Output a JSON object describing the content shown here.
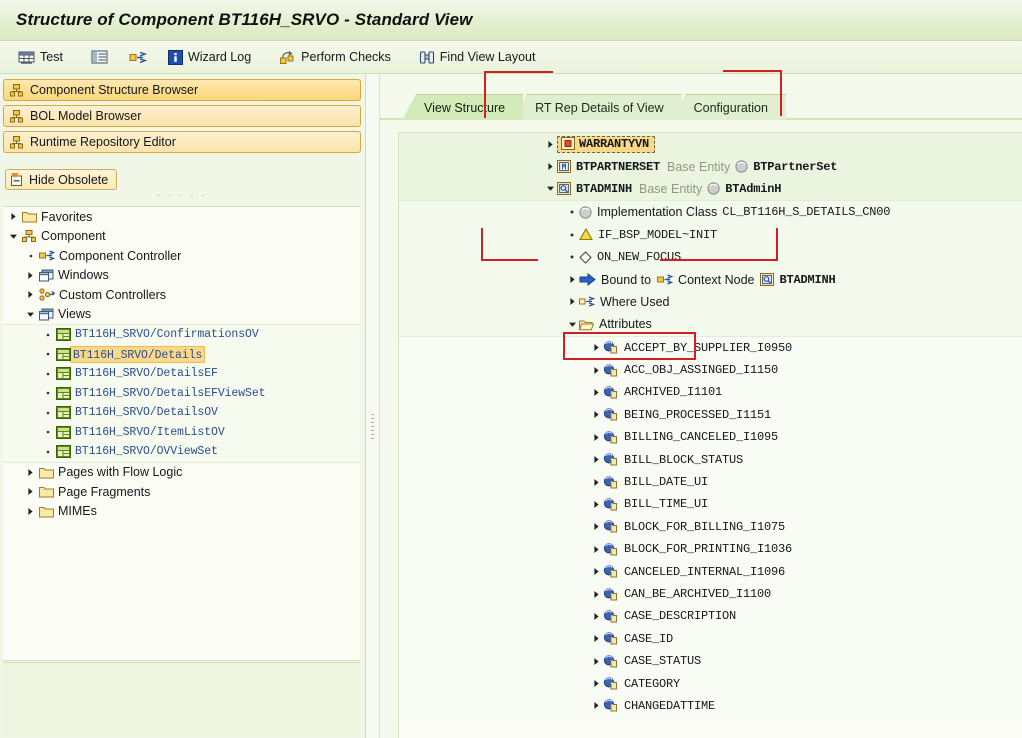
{
  "window": {
    "title": "Structure of Component BT116H_SRVO - Standard View"
  },
  "toolbar": {
    "items": [
      {
        "label": "Test",
        "icon": "test-table-icon"
      },
      {
        "label": "",
        "icon": "list-details-icon"
      },
      {
        "label": "",
        "icon": "navigate-arrows-icon"
      },
      {
        "label": "Wizard Log",
        "icon": "info-blue-icon"
      },
      {
        "label": "Perform Checks",
        "icon": "perform-checks-icon"
      },
      {
        "label": "Find View Layout",
        "icon": "binoculars-icon"
      }
    ]
  },
  "sidebar": {
    "nav_buttons": [
      {
        "label": "Component Structure Browser",
        "icon": "structure-browser-icon",
        "active": true
      },
      {
        "label": "BOL Model Browser",
        "icon": "bol-browser-icon",
        "active": false
      },
      {
        "label": "Runtime Repository Editor",
        "icon": "runtime-repo-icon",
        "active": false
      }
    ],
    "hide_obsolete": {
      "label": "Hide Obsolete",
      "icon": "hide-obsolete-icon"
    },
    "tree": [
      {
        "label": "Favorites",
        "icon": "folder-icon",
        "indent": 0,
        "twisty": "collapsed",
        "style": "plain",
        "band": false
      },
      {
        "label": "Component",
        "icon": "component-icon",
        "indent": 0,
        "twisty": "expanded",
        "style": "plain",
        "band": false
      },
      {
        "label": "Component Controller",
        "icon": "controller-icon",
        "indent": 1,
        "twisty": "leaf",
        "style": "plain",
        "band": false
      },
      {
        "label": "Windows",
        "icon": "windows-icon",
        "indent": 1,
        "twisty": "collapsed",
        "style": "plain",
        "band": false
      },
      {
        "label": "Custom Controllers",
        "icon": "custom-ctrl-icon",
        "indent": 1,
        "twisty": "collapsed",
        "style": "plain",
        "band": false
      },
      {
        "label": "Views",
        "icon": "views-icon",
        "indent": 1,
        "twisty": "expanded",
        "style": "plain",
        "band": false
      },
      {
        "label": "BT116H_SRVO/ConfirmationsOV",
        "icon": "view-icon",
        "indent": 2,
        "twisty": "leaf",
        "style": "link",
        "band": true
      },
      {
        "label": "BT116H_SRVO/Details",
        "icon": "view-icon",
        "indent": 2,
        "twisty": "leaf",
        "style": "selected",
        "band": true
      },
      {
        "label": "BT116H_SRVO/DetailsEF",
        "icon": "view-icon",
        "indent": 2,
        "twisty": "leaf",
        "style": "link",
        "band": true
      },
      {
        "label": "BT116H_SRVO/DetailsEFViewSet",
        "icon": "view-icon",
        "indent": 2,
        "twisty": "leaf",
        "style": "link",
        "band": true
      },
      {
        "label": "BT116H_SRVO/DetailsOV",
        "icon": "view-icon",
        "indent": 2,
        "twisty": "leaf",
        "style": "link",
        "band": true
      },
      {
        "label": "BT116H_SRVO/ItemListOV",
        "icon": "view-icon",
        "indent": 2,
        "twisty": "leaf",
        "style": "link",
        "band": true
      },
      {
        "label": "BT116H_SRVO/OVViewSet",
        "icon": "view-icon",
        "indent": 2,
        "twisty": "leaf",
        "style": "link",
        "band": true
      },
      {
        "label": "Pages with Flow Logic",
        "icon": "folder-icon",
        "indent": 1,
        "twisty": "collapsed",
        "style": "plain",
        "band": false
      },
      {
        "label": "Page Fragments",
        "icon": "folder-icon",
        "indent": 1,
        "twisty": "collapsed",
        "style": "plain",
        "band": false
      },
      {
        "label": "MIMEs",
        "icon": "folder-icon",
        "indent": 1,
        "twisty": "collapsed",
        "style": "plain",
        "band": false
      }
    ]
  },
  "tabs": [
    {
      "label": "View Structure",
      "active": true
    },
    {
      "label": "RT Rep Details of View",
      "active": false
    },
    {
      "label": "Configuration",
      "active": false
    }
  ],
  "view_structure": {
    "rows": [
      {
        "kind": "node-highlight",
        "twisty": "collapsed",
        "icon": "context-node-orange-icon",
        "text": "WARRANTYVN",
        "indent": 0,
        "band": 1
      },
      {
        "kind": "node-entity",
        "twisty": "collapsed",
        "icon": "model-node-icon",
        "text": "BTPARTNERSET",
        "suffix_muted": "Base Entity",
        "suffix_icon": "sphere-grey-icon",
        "suffix_text": "BTPartnerSet",
        "indent": 0,
        "band": 1
      },
      {
        "kind": "node-entity",
        "twisty": "expanded",
        "icon": "context-node-icon",
        "text": "BTADMINH",
        "suffix_muted": "Base Entity",
        "suffix_icon": "sphere-grey-icon",
        "suffix_text": "BTAdminH",
        "indent": 0,
        "band": 1
      },
      {
        "kind": "detail",
        "twisty": "bullet",
        "icon": "sphere-grey-icon",
        "text_sans": "Implementation Class",
        "text_mono": "CL_BT116H_S_DETAILS_CN00",
        "indent": 1,
        "band": 2
      },
      {
        "kind": "detail",
        "twisty": "bullet",
        "icon": "warning-triangle-icon",
        "text_mono": "IF_BSP_MODEL~INIT",
        "indent": 1,
        "band": 2
      },
      {
        "kind": "detail",
        "twisty": "bullet",
        "icon": "diamond-icon",
        "text_mono": "ON_NEW_FOCUS",
        "indent": 1,
        "band": 2
      },
      {
        "kind": "bound",
        "twisty": "collapsed",
        "icon": "blue-arrow-icon",
        "text_sans": "Bound to",
        "mid_icon": "controller-icon",
        "mid_text": "Context Node",
        "end_icon": "context-node-icon",
        "end_text": "BTADMINH",
        "indent": 1,
        "band": 2
      },
      {
        "kind": "detail",
        "twisty": "collapsed",
        "icon": "where-used-icon",
        "text_sans": "Where Used",
        "indent": 1,
        "band": 2
      },
      {
        "kind": "attributes",
        "twisty": "expanded",
        "icon": "folder-open-icon",
        "text_sans": "Attributes",
        "indent": 1,
        "band": 2,
        "annotated": true
      }
    ],
    "attributes": [
      "ACCEPT_BY_SUPPLIER_I0950",
      "ACC_OBJ_ASSINGED_I1150",
      "ARCHIVED_I1101",
      "BEING_PROCESSED_I1151",
      "BILLING_CANCELED_I1095",
      "BILL_BLOCK_STATUS",
      "BILL_DATE_UI",
      "BILL_TIME_UI",
      "BLOCK_FOR_BILLING_I1075",
      "BLOCK_FOR_PRINTING_I1036",
      "CANCELED_INTERNAL_I1096",
      "CAN_BE_ARCHIVED_I1100",
      "CASE_DESCRIPTION",
      "CASE_ID",
      "CASE_STATUS",
      "CATEGORY",
      "CHANGEDATTIME"
    ],
    "attribute_icon": "attribute-blue-icon"
  },
  "annotations": {
    "color": "#d02020",
    "note": "red callout lines pointing to View Structure tab, Configuration tab, IF_BSP_MODEL~INIT and a box around Attributes"
  },
  "colors": {
    "title_bg": "#e3efd0",
    "accent_orange": "#fbd98b",
    "band_dark": "#eaf4de",
    "band_light": "#f3faed",
    "link": "#2b4f8e",
    "annotation_red": "#d02020"
  }
}
